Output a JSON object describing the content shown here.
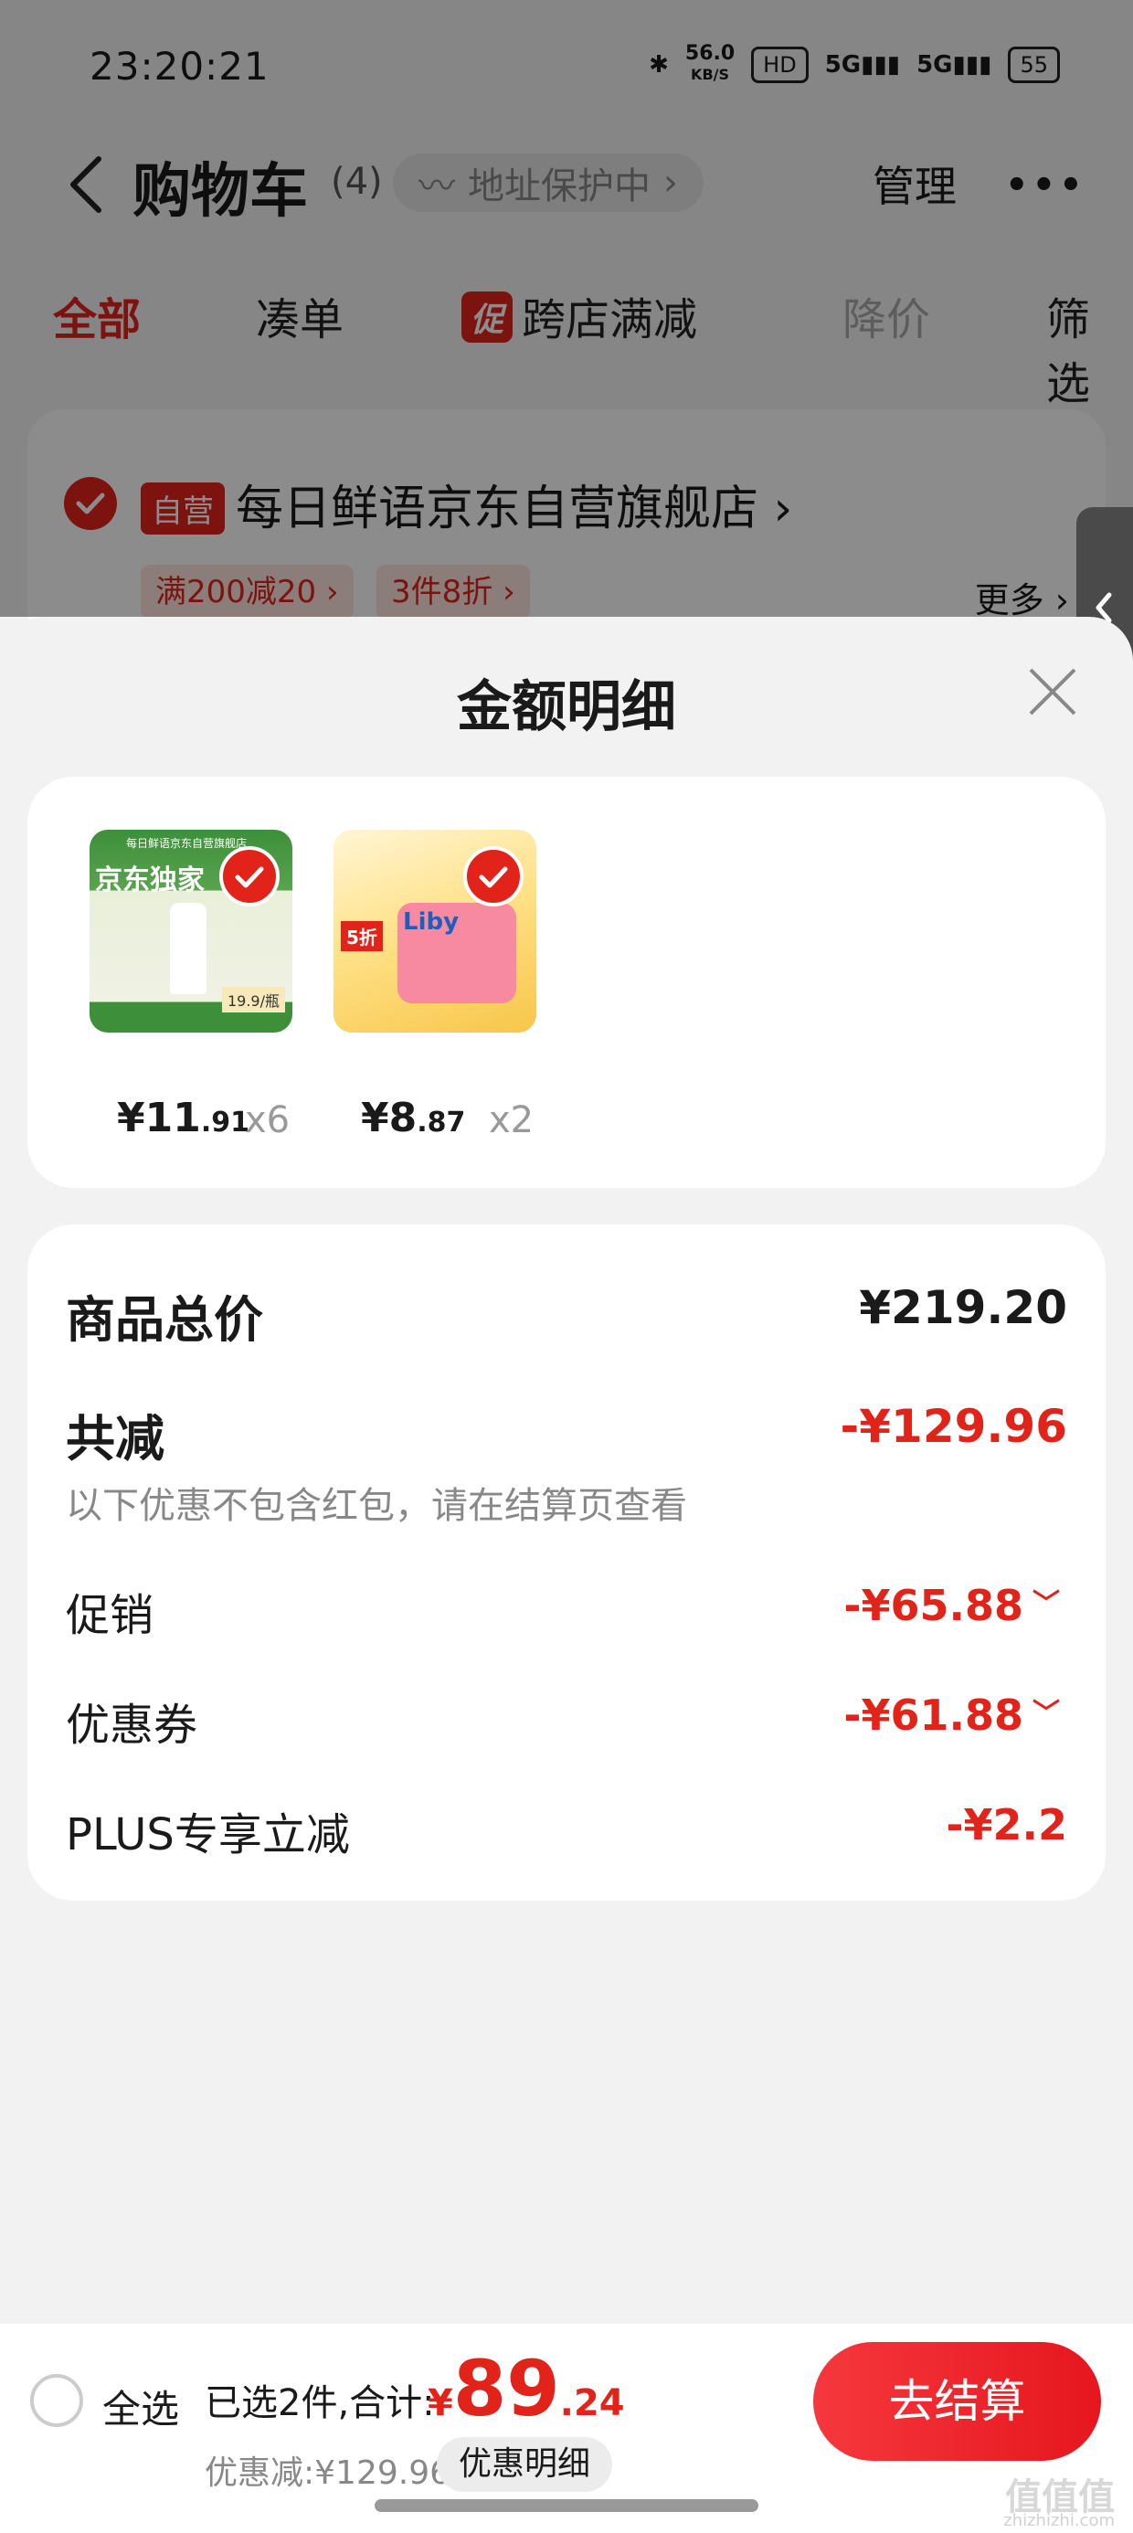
{
  "status_bar": {
    "time": "23:20:21",
    "speed": "56.0",
    "speed_unit": "KB/S",
    "hd": "HD",
    "sig1": "5G",
    "sig2": "5G",
    "battery": "55"
  },
  "nav": {
    "title": "购物车",
    "count": "(4)",
    "address": "地址保护中",
    "manage": "管理",
    "more": "•••"
  },
  "tabs": [
    {
      "label": "全部",
      "state": "active"
    },
    {
      "label": "凑单",
      "state": "normal"
    },
    {
      "label": "跨店满减",
      "badge": "促",
      "state": "normal"
    },
    {
      "label": "降价",
      "state": "disabled"
    },
    {
      "label": "筛选",
      "state": "normal"
    }
  ],
  "store": {
    "badge": "自营",
    "name": "每日鲜语京东自营旗舰店",
    "coupons": [
      "满200减20",
      "3件8折"
    ],
    "more": "更多"
  },
  "sheet": {
    "title": "金额明细",
    "products": [
      {
        "price_int": "¥11",
        "price_dec": ".91",
        "qty": "x6",
        "thumb_text": "京东独家",
        "thumb_sub": "每日鲜语京东自营旗舰店",
        "thumb_tag": "19.9/瓶"
      },
      {
        "price_int": "¥8",
        "price_dec": ".87",
        "qty": "x2",
        "thumb_text": "Liby",
        "thumb_sub": "5折"
      }
    ],
    "summary": {
      "total_label": "商品总价",
      "total_value": "¥219.20",
      "reduce_label": "共减",
      "reduce_value": "-¥129.96",
      "note": "以下优惠不包含红包，请在结算页查看",
      "promo_label": "促销",
      "promo_value": "-¥65.88",
      "coupon_label": "优惠券",
      "coupon_value": "-¥61.88",
      "plus_label": "PLUS专享立减",
      "plus_value": "-¥2.2"
    }
  },
  "bottom": {
    "select_all": "全选",
    "selected": "已选2件,合计:",
    "currency": "¥",
    "total_int": "89",
    "total_dec": ".24",
    "discount": "优惠减:¥129.96",
    "detail": "优惠明细",
    "checkout": "去结算"
  },
  "watermark": "值值值",
  "watermark_url": "zhizhizhi.com",
  "colors": {
    "accent": "#e2231a"
  }
}
